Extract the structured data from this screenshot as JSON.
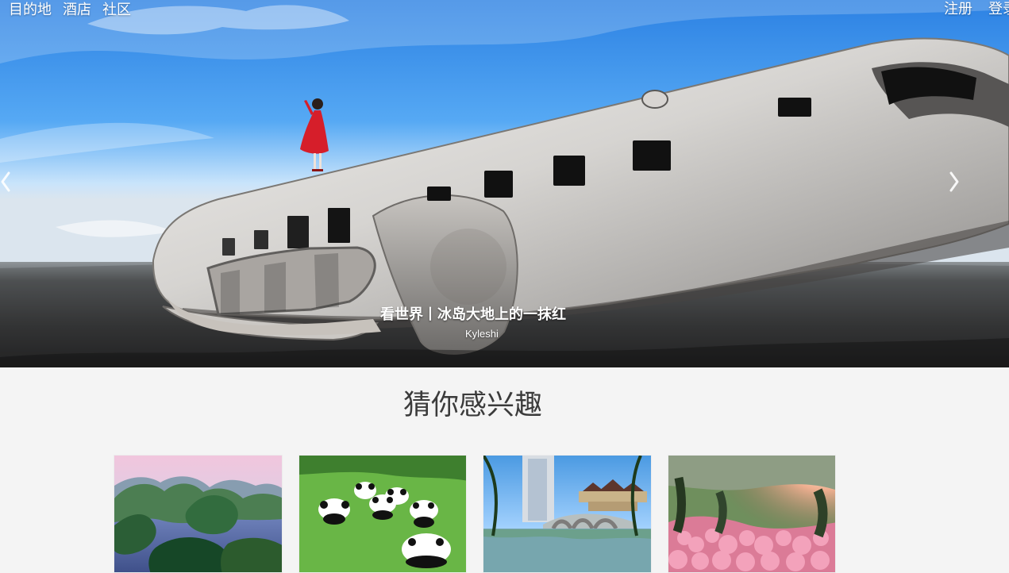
{
  "nav": {
    "left": [
      "目的地",
      "酒店",
      "社区"
    ],
    "right": [
      "注册",
      "登录"
    ]
  },
  "hero": {
    "title": "看世界丨冰岛大地上的一抹红",
    "author": "Kyleshi"
  },
  "section": {
    "title": "猜你感兴趣"
  },
  "cards": [
    {
      "name": "lake-card"
    },
    {
      "name": "panda-card"
    },
    {
      "name": "bridge-card"
    },
    {
      "name": "blossom-card"
    }
  ]
}
